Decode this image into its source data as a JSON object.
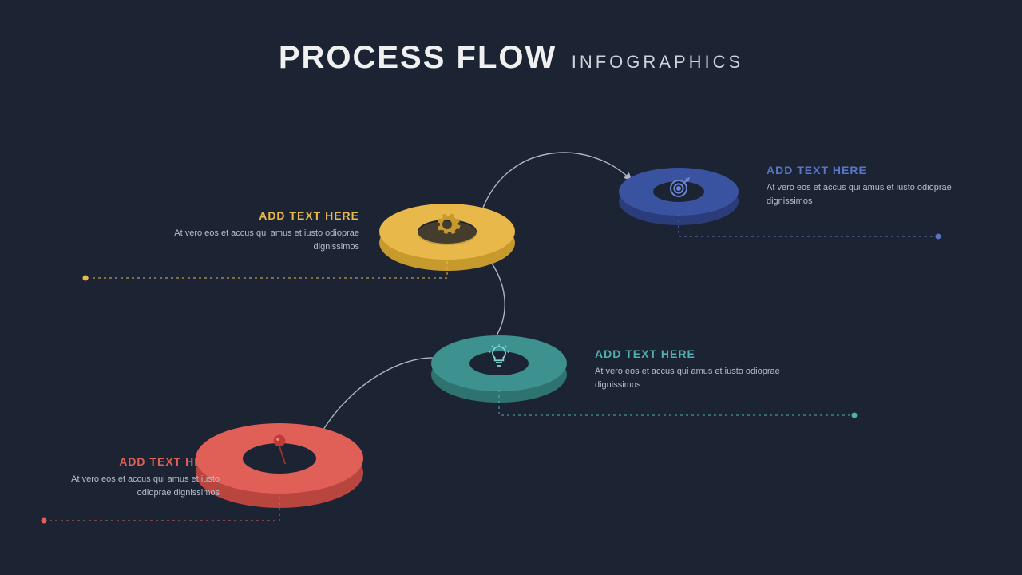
{
  "title": {
    "main": "PROCESS FLOW",
    "sub": "INFOGRAPHICS"
  },
  "nodes": [
    {
      "id": "yellow",
      "heading": "ADD TEXT HERE",
      "body": "At vero eos et accus qui amus et iusto odioprae dignissimos",
      "icon": "gear-icon"
    },
    {
      "id": "blue",
      "heading": "ADD TEXT HERE",
      "body": "At vero eos et accus qui amus et iusto odioprae dignissimos",
      "icon": "target-icon"
    },
    {
      "id": "teal",
      "heading": "ADD TEXT HERE",
      "body": "At vero eos et accus qui amus et iusto odioprae dignissimos",
      "icon": "lightbulb-icon"
    },
    {
      "id": "red",
      "heading": "ADD TEXT HERE",
      "body": "At vero eos et accus qui amus et iusto odioprae dignissimos",
      "icon": "pin-icon"
    }
  ],
  "colors": {
    "background": "#1c2333",
    "yellow": "#e8b84a",
    "blue": "#3a53a0",
    "teal": "#3d918f",
    "red": "#e06058"
  }
}
